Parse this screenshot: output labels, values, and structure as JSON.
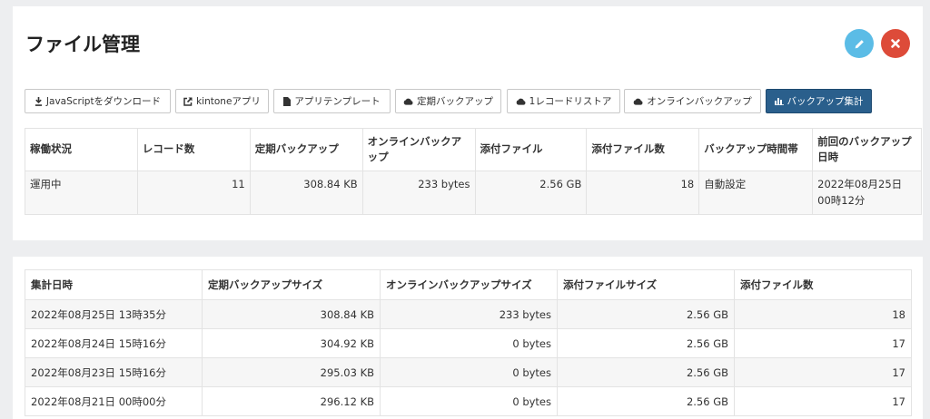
{
  "header": {
    "title": "ファイル管理"
  },
  "colors": {
    "edit": "#5bbce6",
    "close": "#dd4b39",
    "primary": "#2a5f8c"
  },
  "toolbar": {
    "buttons": [
      {
        "label": "JavaScriptをダウンロード",
        "icon": "download-icon"
      },
      {
        "label": "kintoneアプリ",
        "icon": "external-link-icon"
      },
      {
        "label": "アプリテンプレート",
        "icon": "file-icon"
      },
      {
        "label": "定期バックアップ",
        "icon": "cloud-icon"
      },
      {
        "label": "1レコードリストア",
        "icon": "cloud-icon"
      },
      {
        "label": "オンラインバックアップ",
        "icon": "cloud-icon"
      },
      {
        "label": "バックアップ集計",
        "icon": "bar-chart-icon"
      }
    ]
  },
  "status": {
    "headers": [
      "稼働状況",
      "レコード数",
      "定期バックアップ",
      "オンラインバックアップ",
      "添付ファイル",
      "添付ファイル数",
      "バックアップ時間帯",
      "前回のバックアップ日時"
    ],
    "row": [
      "運用中",
      "11",
      "308.84 KB",
      "233 bytes",
      "2.56 GB",
      "18",
      "自動設定",
      "2022年08月25日 00時12分"
    ]
  },
  "history": {
    "headers": [
      "集計日時",
      "定期バックアップサイズ",
      "オンラインバックアップサイズ",
      "添付ファイルサイズ",
      "添付ファイル数"
    ],
    "rows": [
      [
        "2022年08月25日 13時35分",
        "308.84 KB",
        "233 bytes",
        "2.56 GB",
        "18"
      ],
      [
        "2022年08月24日 15時16分",
        "304.92 KB",
        "0 bytes",
        "2.56 GB",
        "17"
      ],
      [
        "2022年08月23日 15時16分",
        "295.03 KB",
        "0 bytes",
        "2.56 GB",
        "17"
      ],
      [
        "2022年08月21日 00時00分",
        "296.12 KB",
        "0 bytes",
        "2.56 GB",
        "17"
      ]
    ]
  }
}
